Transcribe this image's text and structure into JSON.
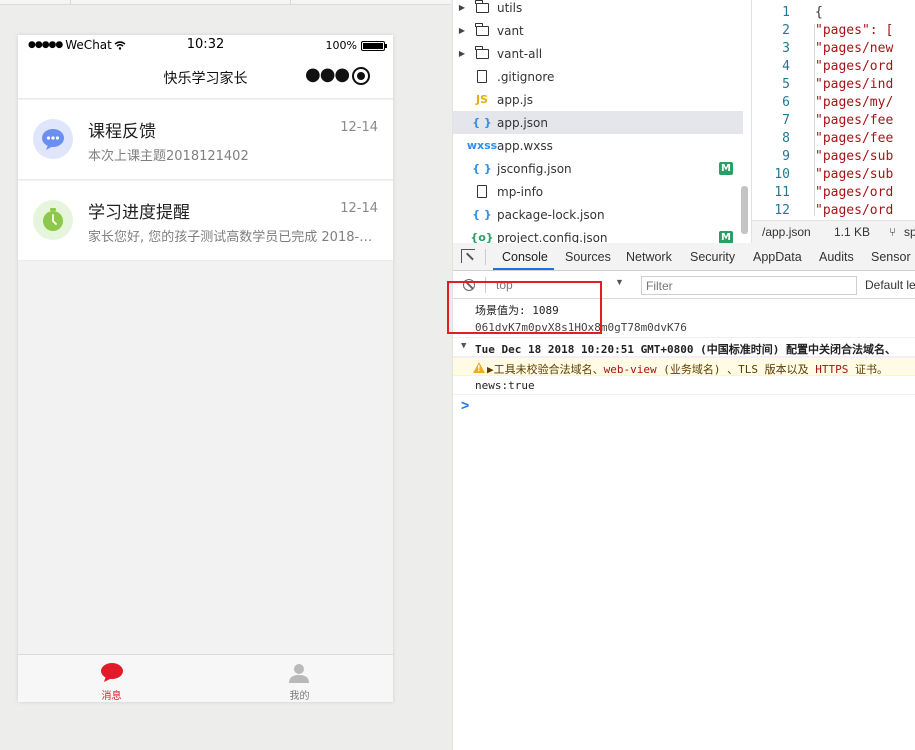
{
  "phone": {
    "status": {
      "carrier": "WeChat",
      "time": "10:32",
      "battery": "100%"
    },
    "nav_title": "快乐学习家长",
    "messages": [
      {
        "title": "课程反馈",
        "date": "12-14",
        "preview": "本次上课主题2018121402"
      },
      {
        "title": "学习进度提醒",
        "date": "12-14",
        "preview": "家长您好, 您的孩子测试高数学员已完成 2018-12-1..."
      }
    ],
    "tabs": [
      {
        "label": "消息"
      },
      {
        "label": "我的"
      }
    ],
    "colors": {
      "accent": "#e21b2b",
      "tab_inactive": "#7a7a7a"
    }
  },
  "file_tree": {
    "items": [
      {
        "name": "utils",
        "type": "folder",
        "icon": "folder-icon"
      },
      {
        "name": "vant",
        "type": "folder",
        "icon": "folder-icon"
      },
      {
        "name": "vant-all",
        "type": "folder",
        "icon": "folder-icon"
      },
      {
        "name": ".gitignore",
        "type": "file",
        "icon": "file-icon"
      },
      {
        "name": "app.js",
        "type": "js",
        "icon": "js-icon",
        "icon_text": "JS"
      },
      {
        "name": "app.json",
        "type": "json",
        "icon": "json-icon",
        "icon_text": "{ }",
        "selected": true
      },
      {
        "name": "app.wxss",
        "type": "wxss",
        "icon": "wxss-icon",
        "icon_text": "wxss"
      },
      {
        "name": "jsconfig.json",
        "type": "json",
        "icon": "json-icon",
        "icon_text": "{ }",
        "badge": "M"
      },
      {
        "name": "mp-info",
        "type": "file",
        "icon": "file-icon"
      },
      {
        "name": "package-lock.json",
        "type": "json",
        "icon": "json-icon",
        "icon_text": "{ }"
      },
      {
        "name": "project.config.json",
        "type": "config",
        "icon": "config-icon",
        "icon_text": "{o}",
        "badge": "M"
      }
    ]
  },
  "editor": {
    "lines": [
      {
        "n": "1",
        "code": "{"
      },
      {
        "n": "2",
        "code": "  \"pages\": ["
      },
      {
        "n": "3",
        "code": "    \"pages/new"
      },
      {
        "n": "4",
        "code": "    \"pages/ord"
      },
      {
        "n": "5",
        "code": "    \"pages/ind"
      },
      {
        "n": "6",
        "code": "    \"pages/my/"
      },
      {
        "n": "7",
        "code": "    \"pages/fee"
      },
      {
        "n": "8",
        "code": "    \"pages/fee"
      },
      {
        "n": "9",
        "code": "    \"pages/sub"
      },
      {
        "n": "10",
        "code": "    \"pages/sub"
      },
      {
        "n": "11",
        "code": "    \"pages/ord"
      },
      {
        "n": "12",
        "code": "    \"pages/ord"
      }
    ],
    "status": {
      "path": "/app.json",
      "size": "1.1 KB",
      "branch": "sp"
    }
  },
  "devtools": {
    "tabs": [
      "Console",
      "Sources",
      "Network",
      "Security",
      "AppData",
      "Audits",
      "Sensor"
    ],
    "active_tab": "Console",
    "context": "top",
    "filter_placeholder": "Filter",
    "levels": "Default le",
    "console": {
      "line1": "场景值为: 1089",
      "line2": "061dvK7m0pvX8s1HOx8m0gT78m0dvK76",
      "group_header": "Tue Dec 18 2018 10:20:51 GMT+0800 (中国标准时间) 配置中关闭合法域名、",
      "warning": "▶工具未校验合法域名、web-view (业务域名) 、TLS 版本以及 HTTPS 证书。",
      "line3": "news:true",
      "prompt": ">"
    }
  }
}
